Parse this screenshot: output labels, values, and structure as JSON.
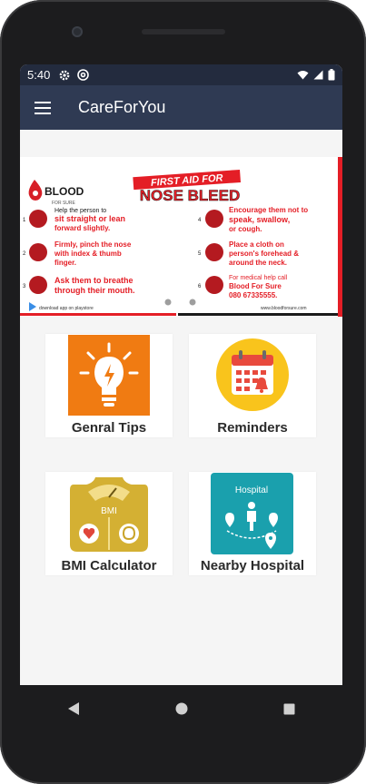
{
  "status": {
    "time": "5:40"
  },
  "appbar": {
    "title": "CareForYou"
  },
  "banner": {
    "brand": "BLOOD",
    "brand_sub": "FOR SURE",
    "tag": "FIRST AID FOR",
    "headline": "NOSE BLEED",
    "steps": [
      {
        "num": "1",
        "line1": "Help the person to",
        "line2": "sit straight or lean",
        "line3": "forward slightly."
      },
      {
        "num": "2",
        "line1": "Firmly, pinch the nose",
        "line2": "with index & thumb",
        "line3": "finger."
      },
      {
        "num": "3",
        "line1": "Ask them to breathe",
        "line2": "through their mouth.",
        "line3": ""
      },
      {
        "num": "4",
        "line1": "Encourage them not to",
        "line2": "speak, swallow,",
        "line3": "or cough."
      },
      {
        "num": "5",
        "line1": "Place a cloth on",
        "line2": "person's forehead &",
        "line3": "around the neck."
      },
      {
        "num": "6",
        "line1": "For medical help call",
        "line2": "Blood For Sure",
        "line3": "080 67335555."
      }
    ],
    "footer_left": "download app on playstore",
    "footer_right": "www.bloodforsure.com"
  },
  "tiles": [
    {
      "label": "Genral Tips",
      "icon": "bulb-icon"
    },
    {
      "label": "Reminders",
      "icon": "calendar-icon"
    },
    {
      "label": "BMI Calculator",
      "icon": "scale-icon",
      "badge": "BMI"
    },
    {
      "label": "Nearby Hospital",
      "icon": "hospital-map-icon",
      "caption": "Hospital"
    }
  ],
  "colors": {
    "appbar": "#2f3a53",
    "statusbar": "#232b3e",
    "red": "#e41e26",
    "orange": "#f57d0a",
    "teal": "#1aa3b0"
  }
}
